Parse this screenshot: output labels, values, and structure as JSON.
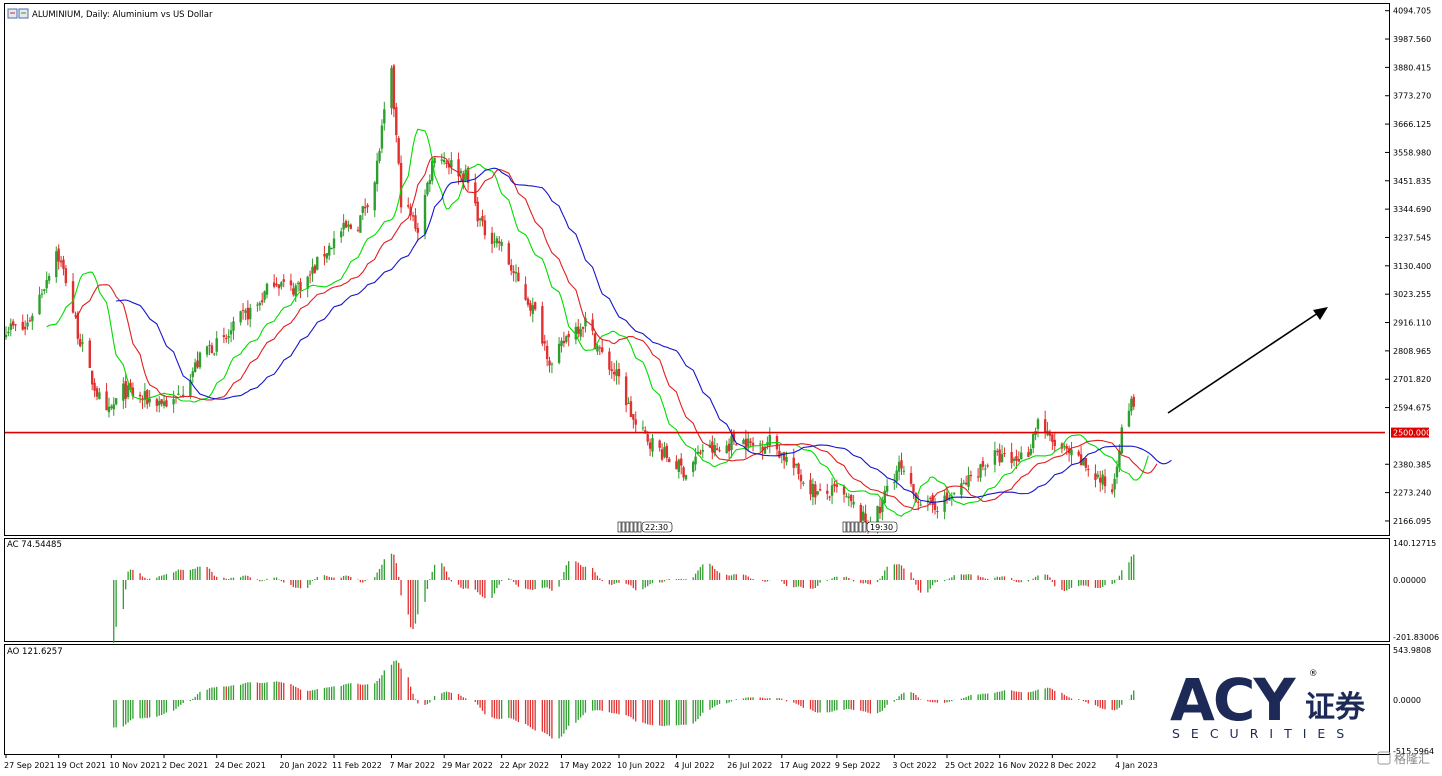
{
  "header": {
    "title": "ALUMINIUM, Daily:  Aluminium vs US Dollar"
  },
  "price_axis": {
    "labels": [
      "4094.705",
      "3987.560",
      "3880.415",
      "3773.270",
      "3666.125",
      "3558.980",
      "3451.835",
      "3344.690",
      "3237.545",
      "3130.400",
      "3023.255",
      "2916.110",
      "2808.965",
      "2701.820",
      "2594.675",
      "2380.385",
      "2273.240",
      "2166.095"
    ],
    "hline_label": "2500.000"
  },
  "ac_panel": {
    "label": "AC 74.54485",
    "axis_labels": [
      "140.12715",
      "0.00000",
      "-201.83006"
    ]
  },
  "ao_panel": {
    "label": "AO 121.6257",
    "axis_labels": [
      "543.9808",
      "0.0000",
      "-515.5964"
    ]
  },
  "time_axis": {
    "labels": [
      "27 Sep 2021",
      "19 Oct 2021",
      "10 Nov 2021",
      "2 Dec 2021",
      "24 Dec 2021",
      "20 Jan 2022",
      "11 Feb 2022",
      "7 Mar 2022",
      "29 Mar 2022",
      "22 Apr 2022",
      "17 May 2022",
      "10 Jun 2022",
      "4 Jul 2022",
      "26 Jul 2022",
      "17 Aug 2022",
      "9 Sep 2022",
      "3 Oct 2022",
      "25 Oct 2022",
      "16 Nov 2022",
      "8 Dec 2022",
      "4 Jan 2023"
    ]
  },
  "event_markers": [
    "22:30",
    "19:30"
  ],
  "logo": {
    "brand": "ACY",
    "chinese": "证券",
    "sub": "SECURITIES",
    "registered": "®"
  },
  "watermark": "格隆汇",
  "colors": {
    "bull": "#2e9e2e",
    "bear": "#e03030",
    "ma_fast": "#00dd00",
    "ma_mid": "#e02020",
    "ma_slow": "#1515cc",
    "hline": "#dd0000",
    "logo": "#1d2a57"
  },
  "chart_data": {
    "type": "candlestick",
    "series_name": "ALUMINIUM, Daily",
    "x_range": [
      "27 Sep 2021",
      "11 Jan 2023"
    ],
    "ylim": [
      2113,
      4120
    ],
    "horizontal_line": 2500,
    "close_path_keypoints": [
      [
        "27 Sep 2021",
        2900
      ],
      [
        "5 Oct 2021",
        2890
      ],
      [
        "13 Oct 2021",
        3060
      ],
      [
        "18 Oct 2021",
        3190
      ],
      [
        "22 Oct 2021",
        3080
      ],
      [
        "27 Oct 2021",
        2880
      ],
      [
        "1 Nov 2021",
        2720
      ],
      [
        "8 Nov 2021",
        2560
      ],
      [
        "15 Nov 2021",
        2660
      ],
      [
        "22 Nov 2021",
        2630
      ],
      [
        "29 Nov 2021",
        2620
      ],
      [
        "6 Dec 2021",
        2610
      ],
      [
        "13 Dec 2021",
        2720
      ],
      [
        "20 Dec 2021",
        2820
      ],
      [
        "27 Dec 2021",
        2840
      ],
      [
        "3 Jan 2022",
        2930
      ],
      [
        "10 Jan 2022",
        2980
      ],
      [
        "17 Jan 2022",
        3080
      ],
      [
        "24 Jan 2022",
        3040
      ],
      [
        "31 Jan 2022",
        3080
      ],
      [
        "7 Feb 2022",
        3180
      ],
      [
        "14 Feb 2022",
        3260
      ],
      [
        "21 Feb 2022",
        3290
      ],
      [
        "28 Feb 2022",
        3450
      ],
      [
        "4 Mar 2022",
        3700
      ],
      [
        "7 Mar 2022",
        3850
      ],
      [
        "11 Mar 2022",
        3380
      ],
      [
        "18 Mar 2022",
        3270
      ],
      [
        "25 Mar 2022",
        3560
      ],
      [
        "31 Mar 2022",
        3520
      ],
      [
        "7 Apr 2022",
        3470
      ],
      [
        "14 Apr 2022",
        3270
      ],
      [
        "21 Apr 2022",
        3220
      ],
      [
        "28 Apr 2022",
        3080
      ],
      [
        "6 May 2022",
        2950
      ],
      [
        "13 May 2022",
        2750
      ],
      [
        "20 May 2022",
        2880
      ],
      [
        "27 May 2022",
        2920
      ],
      [
        "3 Jun 2022",
        2790
      ],
      [
        "10 Jun 2022",
        2700
      ],
      [
        "17 Jun 2022",
        2520
      ],
      [
        "24 Jun 2022",
        2460
      ],
      [
        "1 Jul 2022",
        2400
      ],
      [
        "8 Jul 2022",
        2350
      ],
      [
        "15 Jul 2022",
        2440
      ],
      [
        "22 Jul 2022",
        2430
      ],
      [
        "29 Jul 2022",
        2480
      ],
      [
        "5 Aug 2022",
        2450
      ],
      [
        "12 Aug 2022",
        2470
      ],
      [
        "19 Aug 2022",
        2400
      ],
      [
        "26 Aug 2022",
        2320
      ],
      [
        "2 Sep 2022",
        2260
      ],
      [
        "9 Sep 2022",
        2280
      ],
      [
        "16 Sep 2022",
        2220
      ],
      [
        "21 Sep 2022",
        2160
      ],
      [
        "27 Sep 2022",
        2200
      ],
      [
        "30 Sep 2022",
        2300
      ],
      [
        "5 Oct 2022",
        2370
      ],
      [
        "10 Oct 2022",
        2280
      ],
      [
        "17 Oct 2022",
        2220
      ],
      [
        "24 Oct 2022",
        2240
      ],
      [
        "31 Oct 2022",
        2290
      ],
      [
        "7 Nov 2022",
        2360
      ],
      [
        "14 Nov 2022",
        2410
      ],
      [
        "21 Nov 2022",
        2390
      ],
      [
        "28 Nov 2022",
        2430
      ],
      [
        "2 Dec 2022",
        2550
      ],
      [
        "7 Dec 2022",
        2470
      ],
      [
        "14 Dec 2022",
        2420
      ],
      [
        "21 Dec 2022",
        2380
      ],
      [
        "28 Dec 2022",
        2320
      ],
      [
        "2 Jan 2023",
        2280
      ],
      [
        "5 Jan 2023",
        2460
      ],
      [
        "9 Jan 2023",
        2600
      ],
      [
        "11 Jan 2023",
        2610
      ]
    ],
    "moving_averages": [
      {
        "name": "fast",
        "color": "#00dd00"
      },
      {
        "name": "mid",
        "color": "#e02020"
      },
      {
        "name": "slow",
        "color": "#1515cc"
      }
    ],
    "ac": {
      "last": 74.54485,
      "ylim": [
        -201.83006,
        140.12715
      ]
    },
    "ao": {
      "last": 121.6257,
      "ylim": [
        -515.5964,
        543.9808
      ]
    }
  }
}
